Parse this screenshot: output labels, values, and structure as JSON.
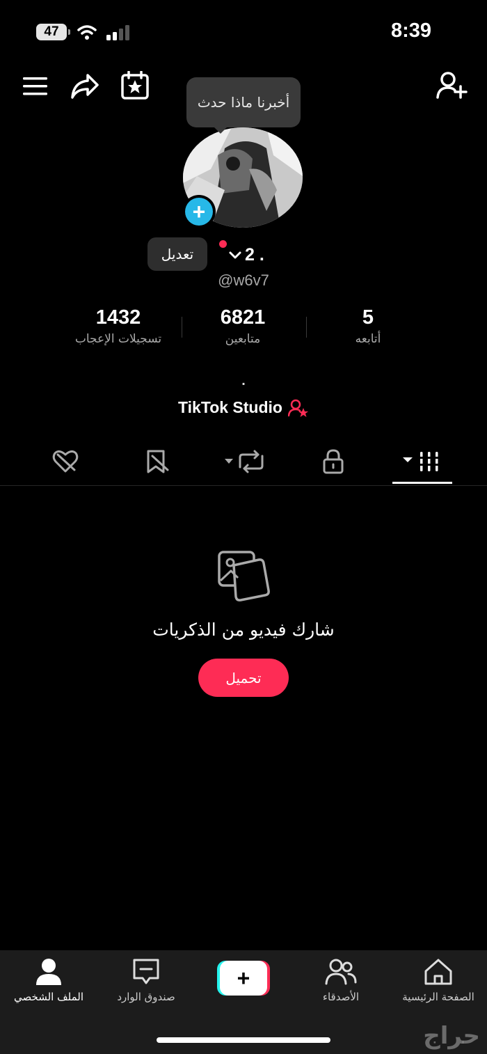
{
  "status_bar": {
    "battery": "47",
    "time": "8:39"
  },
  "header": {
    "icons": [
      "menu-icon",
      "share-icon",
      "calendar-star-icon",
      "add-friend-icon"
    ]
  },
  "tooltip": {
    "text": "أخبرنا ماذا حدث"
  },
  "profile": {
    "name": ". 2",
    "handle": "@w6v7",
    "edit_label": "تعديل",
    "bio": "."
  },
  "stats": [
    {
      "value": "5",
      "label": "أتابعه"
    },
    {
      "value": "6821",
      "label": "متابعين"
    },
    {
      "value": "1432",
      "label": "تسجيلات الإعجاب"
    }
  ],
  "studio": {
    "label": "TikTok Studio"
  },
  "tabs": {
    "icons": [
      "grid-videos-icon",
      "lock-icon",
      "repost-icon",
      "favorites-icon",
      "liked-icon"
    ],
    "active": "grid-videos-icon"
  },
  "empty_state": {
    "title": "شارك فيديو من الذكريات",
    "button": "تحميل"
  },
  "bottom_nav": {
    "home": "الصفحة الرئيسية",
    "friends": "الأصدقاء",
    "create": "+",
    "inbox": "صندوق الوارد",
    "profile": "الملف الشخصي"
  },
  "watermark": "حراج",
  "colors": {
    "accent": "#fe2c55",
    "cyan": "#25f4ee",
    "avatar_plus": "#27b8e8",
    "background": "#000000"
  }
}
